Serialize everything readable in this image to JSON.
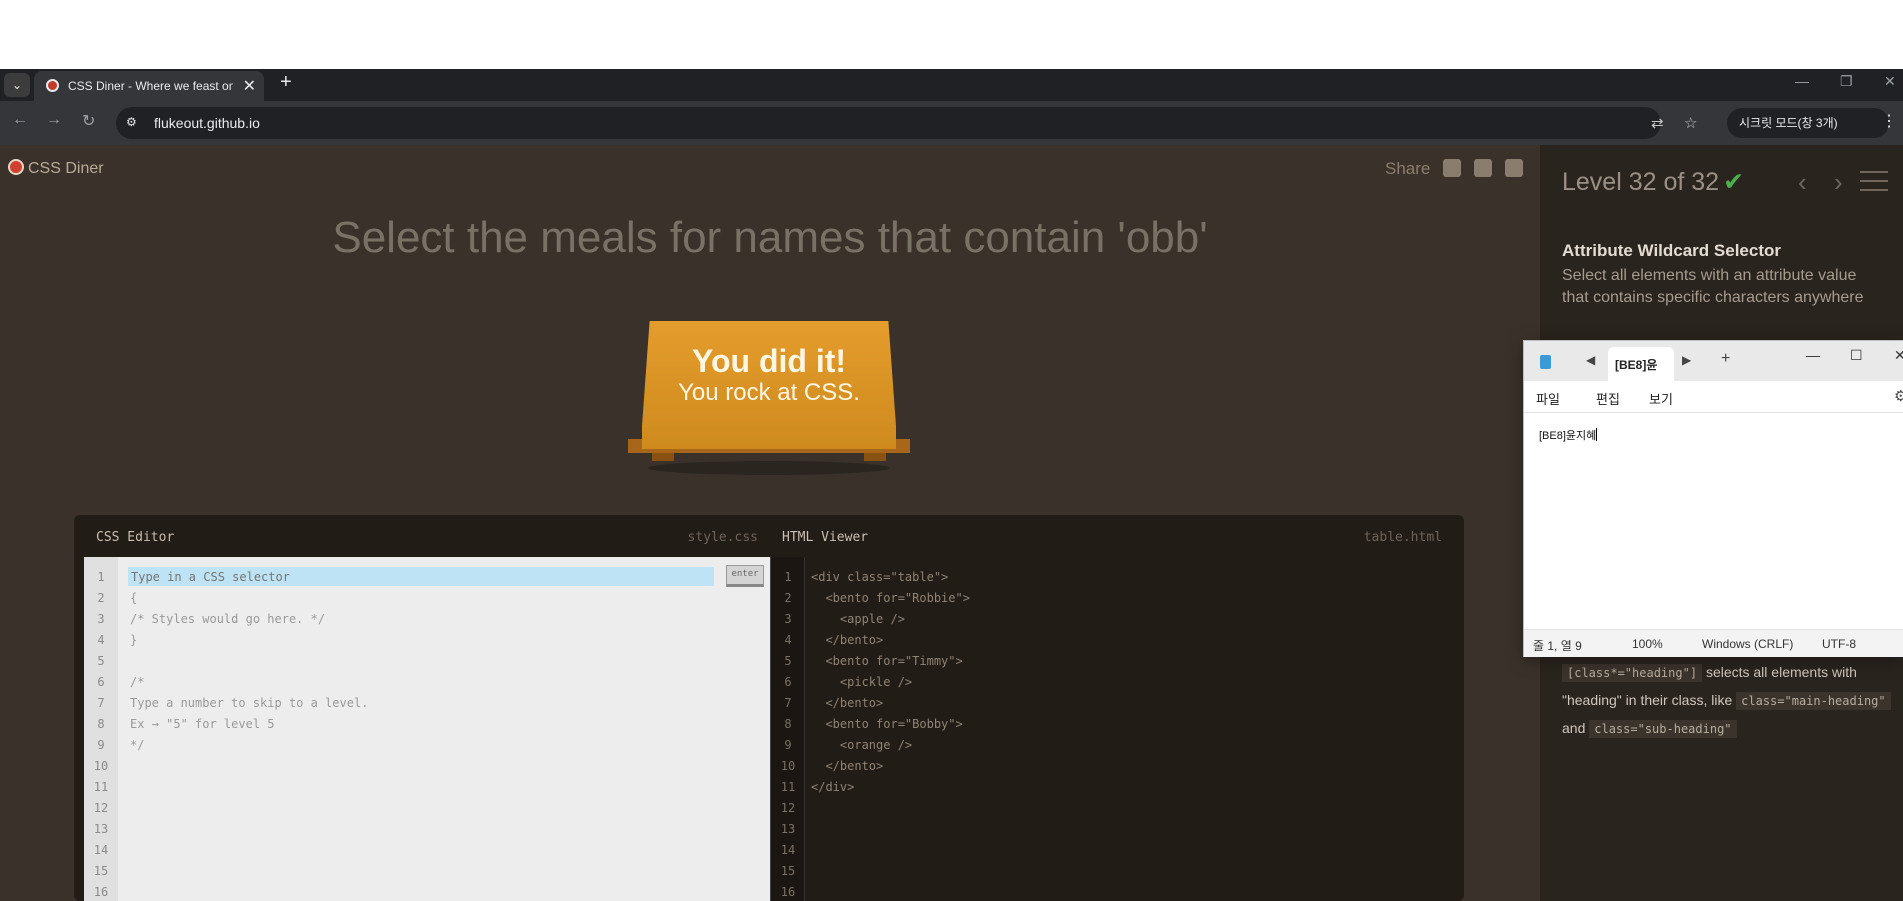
{
  "browser": {
    "tab_title": "CSS Diner - Where we feast on CSS",
    "url": "flukeout.github.io",
    "incognito_label": "시크릿 모드(창 3개)"
  },
  "game": {
    "brand": "CSS Diner",
    "share_label": "Share",
    "order": "Select the meals for names that contain 'obb'",
    "win_line1": "You did it!",
    "win_line2": "You rock at CSS."
  },
  "css_editor": {
    "title": "CSS Editor",
    "filename": "style.css",
    "input_placeholder": "Type in a CSS selector",
    "enter_label": "enter",
    "lines": [
      "{",
      "/* Styles would go here. */",
      "}",
      "",
      "/*",
      "Type a number to skip to a level.",
      "Ex → \"5\" for level 5",
      "*/"
    ],
    "line_numbers": [
      "1",
      "2",
      "3",
      "4",
      "5",
      "6",
      "7",
      "8",
      "9",
      "10",
      "11",
      "12",
      "13",
      "14",
      "15",
      "16"
    ]
  },
  "html_viewer": {
    "title": "HTML Viewer",
    "filename": "table.html",
    "lines": [
      "<div class=\"table\">",
      "  <bento for=\"Robbie\">",
      "    <apple />",
      "  </bento>",
      "  <bento for=\"Timmy\">",
      "    <pickle />",
      "  </bento>",
      "  <bento for=\"Bobby\">",
      "    <orange />",
      "  </bento>",
      "</div>"
    ],
    "line_numbers": [
      "1",
      "2",
      "3",
      "4",
      "5",
      "6",
      "7",
      "8",
      "9",
      "10",
      "11",
      "12",
      "13",
      "14",
      "15",
      "16"
    ]
  },
  "sidebar": {
    "level_text": "Level 32 of 32",
    "check": "✔",
    "prev": "‹",
    "next": "›",
    "selector_name": "Attribute Wildcard Selector",
    "description": "Select all elements with an attribute value that contains specific characters anywhere",
    "ex_code1": "[class*=\"heading\"]",
    "ex_text1": "selects all elements with \"heading\" in their class, like",
    "ex_code2": "class=\"main-heading\"",
    "ex_and": "and",
    "ex_code3": "class=\"sub-heading\""
  },
  "notepad": {
    "tab_title": "[BE8]윤",
    "menu": [
      "파일",
      "편집",
      "보기"
    ],
    "content": "[BE8]윤지혜",
    "status": {
      "position": "줄 1, 열 9",
      "zoom": "100%",
      "line_ending": "Windows (CRLF)",
      "encoding": "UTF-8"
    }
  },
  "colors": {
    "game_bg": "#3a322a",
    "table": "#e49d2c",
    "sidebar_bg": "#2a241e",
    "input_highlight": "#bde3f4"
  }
}
